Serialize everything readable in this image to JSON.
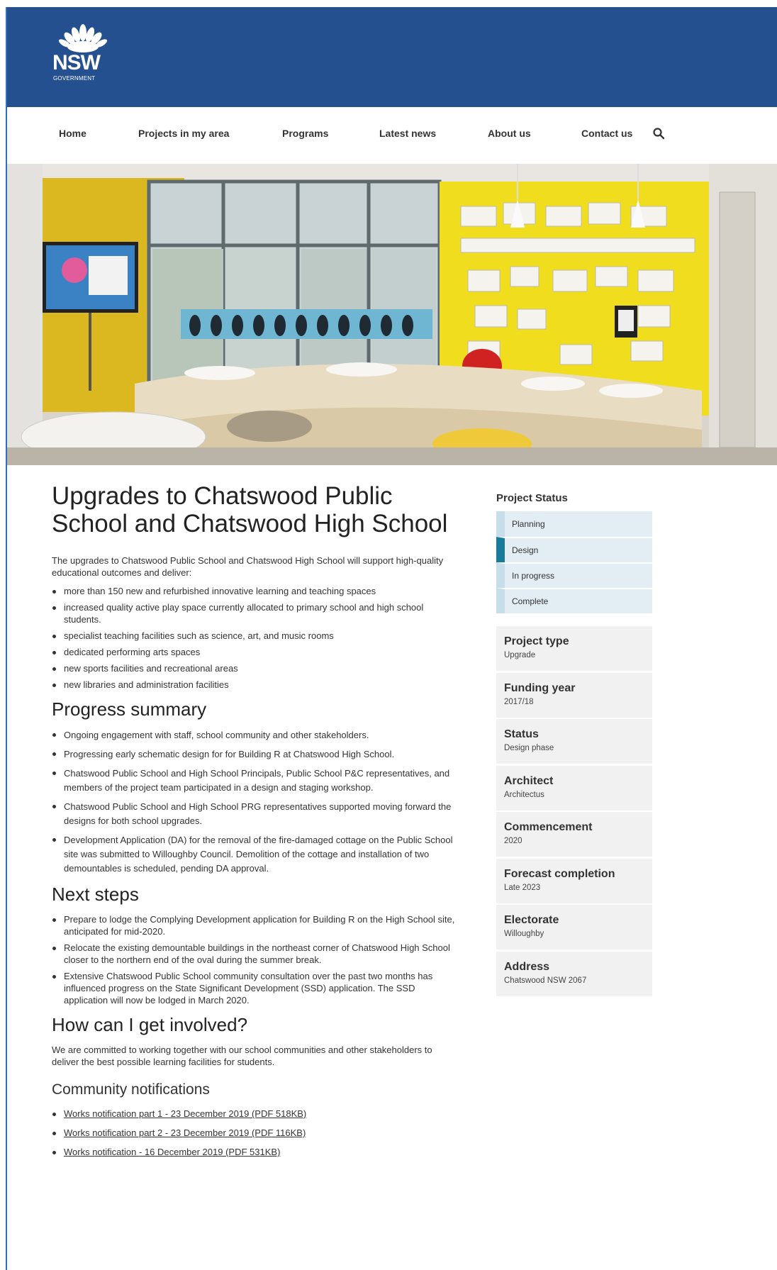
{
  "logo": {
    "text": "NSW",
    "subtext": "GOVERNMENT"
  },
  "nav": {
    "items": [
      "Home",
      "Projects in my area",
      "Programs",
      "Latest news",
      "About us",
      "Contact us"
    ],
    "search_icon": "search-icon"
  },
  "hero": {
    "alt": "Classroom with yellow walls, round tables and a large window"
  },
  "page": {
    "title": "Upgrades to Chatswood Public School and Chatswood High School",
    "intro": "The upgrades to Chatswood Public School and Chatswood High School will support high-quality educational outcomes and deliver:",
    "intro_items": [
      "more than 150 new and refurbished innovative learning and teaching spaces",
      "increased quality active play space currently allocated to primary school and high school students.",
      "specialist teaching facilities such as science, art, and music rooms",
      "dedicated performing arts spaces",
      "new sports facilities and recreational areas",
      "new libraries and administration facilities"
    ],
    "progress_heading": "Progress summary",
    "progress_items": [
      "Ongoing engagement with staff, school community and other stakeholders.",
      "Progressing early schematic design for for Building R at Chatswood High School.",
      "Chatswood Public School and High School Principals, Public School P&C representatives, and members of the project team participated in a design and staging workshop.",
      "Chatswood Public School and High School PRG representatives supported moving forward the designs for both school upgrades.",
      "Development Application (DA) for the removal of the fire-damaged cottage on the Public School site was submitted to Willoughby Council. Demolition of the cottage and installation of two demountables is scheduled, pending DA approval."
    ],
    "next_heading": "Next steps",
    "next_items": [
      "Prepare to lodge the Complying Development application for Building R on the High School site, anticipated for mid-2020.",
      "Relocate the existing demountable buildings in the northeast corner of Chatswood High School closer to the northern end of the oval during the summer break.",
      "Extensive Chatswood Public School community consultation over the past two months has influenced progress on the State Significant Development (SSD) application. The SSD application will now be lodged in March 2020."
    ],
    "involved_heading": "How can I get involved?",
    "involved_text": "We are committed to working together with our school communities and other stakeholders to deliver the best possible learning facilities for students.",
    "notifications_heading": "Community notifications",
    "notifications": [
      "Works notification part 1 - 23 December 2019 (PDF 518KB)",
      "Works notification part 2 - 23 December 2019 (PDF 116KB)",
      "Works notification - 16 December 2019 (PDF 531KB)"
    ]
  },
  "sidebar": {
    "status_heading": "Project Status",
    "steps": [
      "Planning",
      "Design",
      "In progress",
      "Complete"
    ],
    "active_step": "Design",
    "info": [
      {
        "label": "Project type",
        "value": "Upgrade"
      },
      {
        "label": "Funding year",
        "value": "2017/18"
      },
      {
        "label": "Status",
        "value": "Design phase"
      },
      {
        "label": "Architect",
        "value": "Architectus"
      },
      {
        "label": "Commencement",
        "value": "2020"
      },
      {
        "label": "Forecast completion",
        "value": "Late 2023"
      },
      {
        "label": "Electorate",
        "value": "Willoughby"
      },
      {
        "label": "Address",
        "value": "Chatswood NSW 2067"
      }
    ]
  },
  "colors": {
    "header_bg": "#24508f",
    "active_step": "#1a7a9a",
    "step_bg": "#e3eef4",
    "info_bg": "#f1f1f1"
  }
}
